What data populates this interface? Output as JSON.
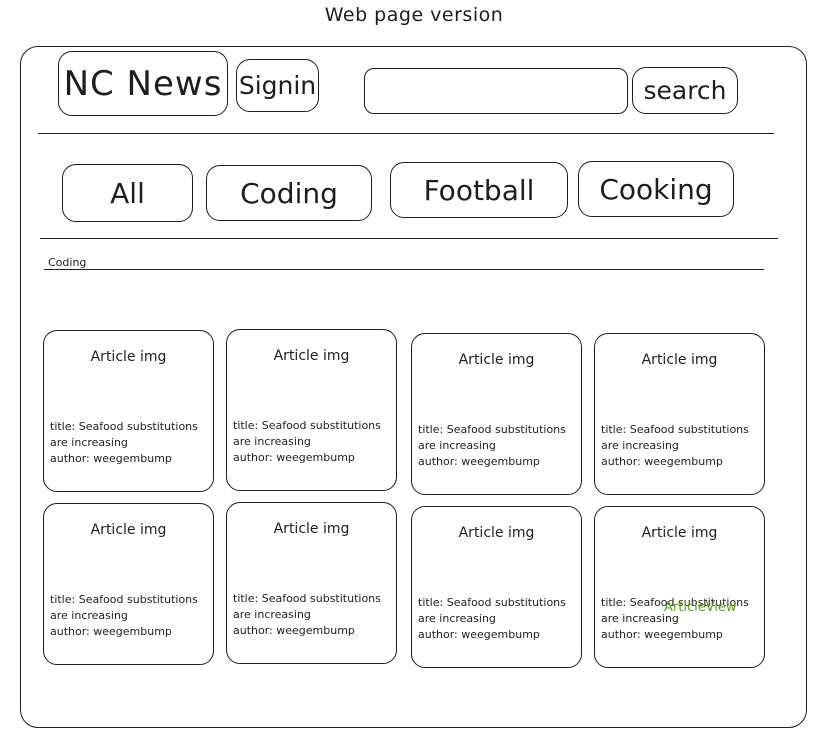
{
  "page_title": "Web page version",
  "header": {
    "logo": "NC News",
    "signin_label": "Signin",
    "search_placeholder": "",
    "search_label": "search"
  },
  "topics": [
    {
      "label": "All"
    },
    {
      "label": "Coding"
    },
    {
      "label": "Football"
    },
    {
      "label": "Cooking"
    }
  ],
  "breadcrumb": "Coding",
  "articles": [
    {
      "img": "Article img",
      "title": "title: Seafood substitutions are increasing",
      "author": "author: weegembump"
    },
    {
      "img": "Article img",
      "title": "title: Seafood substitutions are increasing",
      "author": "author: weegembump"
    },
    {
      "img": "Article img",
      "title": "title: Seafood substitutions are increasing",
      "author": "author: weegembump"
    },
    {
      "img": "Article img",
      "title": "title: Seafood substitutions are increasing",
      "author": "author: weegembump"
    },
    {
      "img": "Article img",
      "title": "title: Seafood substitutions are increasing",
      "author": "author: weegembump"
    },
    {
      "img": "Article img",
      "title": "title: Seafood substitutions are increasing",
      "author": "author: weegembump"
    },
    {
      "img": "Article img",
      "title": "title: Seafood substitutions are increasing",
      "author": "author: weegembump"
    },
    {
      "img": "Article img",
      "title": "title: Seafood substitutions are increasing",
      "author": "author: weegembump"
    }
  ],
  "annotation": "ArticleView",
  "colors": {
    "stroke": "#1e1e1e",
    "annotation": "#5e9e1a"
  }
}
